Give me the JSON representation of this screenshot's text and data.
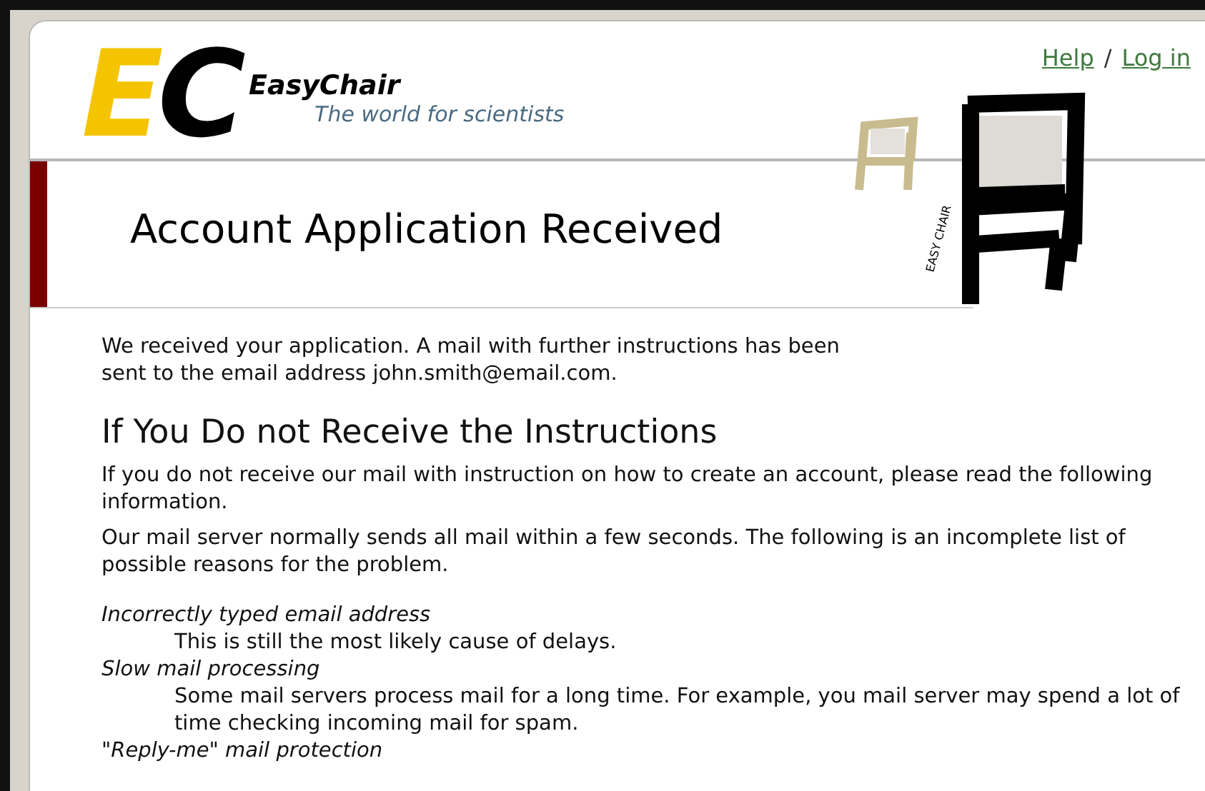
{
  "header": {
    "logo": {
      "letters": [
        {
          "char": "E",
          "color": "#f5c400"
        },
        {
          "char": "C",
          "color": "#000000"
        }
      ],
      "name": "EasyChair",
      "tagline": "The world for scientists"
    },
    "links": [
      {
        "label": "Help"
      },
      {
        "label": "Log in"
      }
    ],
    "separator": "/",
    "chair_caption": "EASY CHAIR"
  },
  "title": "Account Application Received",
  "intro": [
    "We received your application. A mail with further instructions has been",
    "sent to the email address john.smith@email.com."
  ],
  "section": {
    "heading": "If You Do not Receive the Instructions",
    "paragraphs": [
      "If you do not receive our mail with instruction on how to create an account, please read the following information.",
      "Our mail server normally sends all mail within a few seconds. The following is an incomplete list of possible reasons for the problem."
    ],
    "reasons": [
      {
        "term": "Incorrectly typed email address",
        "description": "This is still the most likely cause of delays."
      },
      {
        "term": "Slow mail processing",
        "description": "Some mail servers process mail for a long time. For example, you mail server may spend a lot of time checking incoming mail for spam."
      },
      {
        "term": "\"Reply-me\" mail protection"
      }
    ]
  }
}
